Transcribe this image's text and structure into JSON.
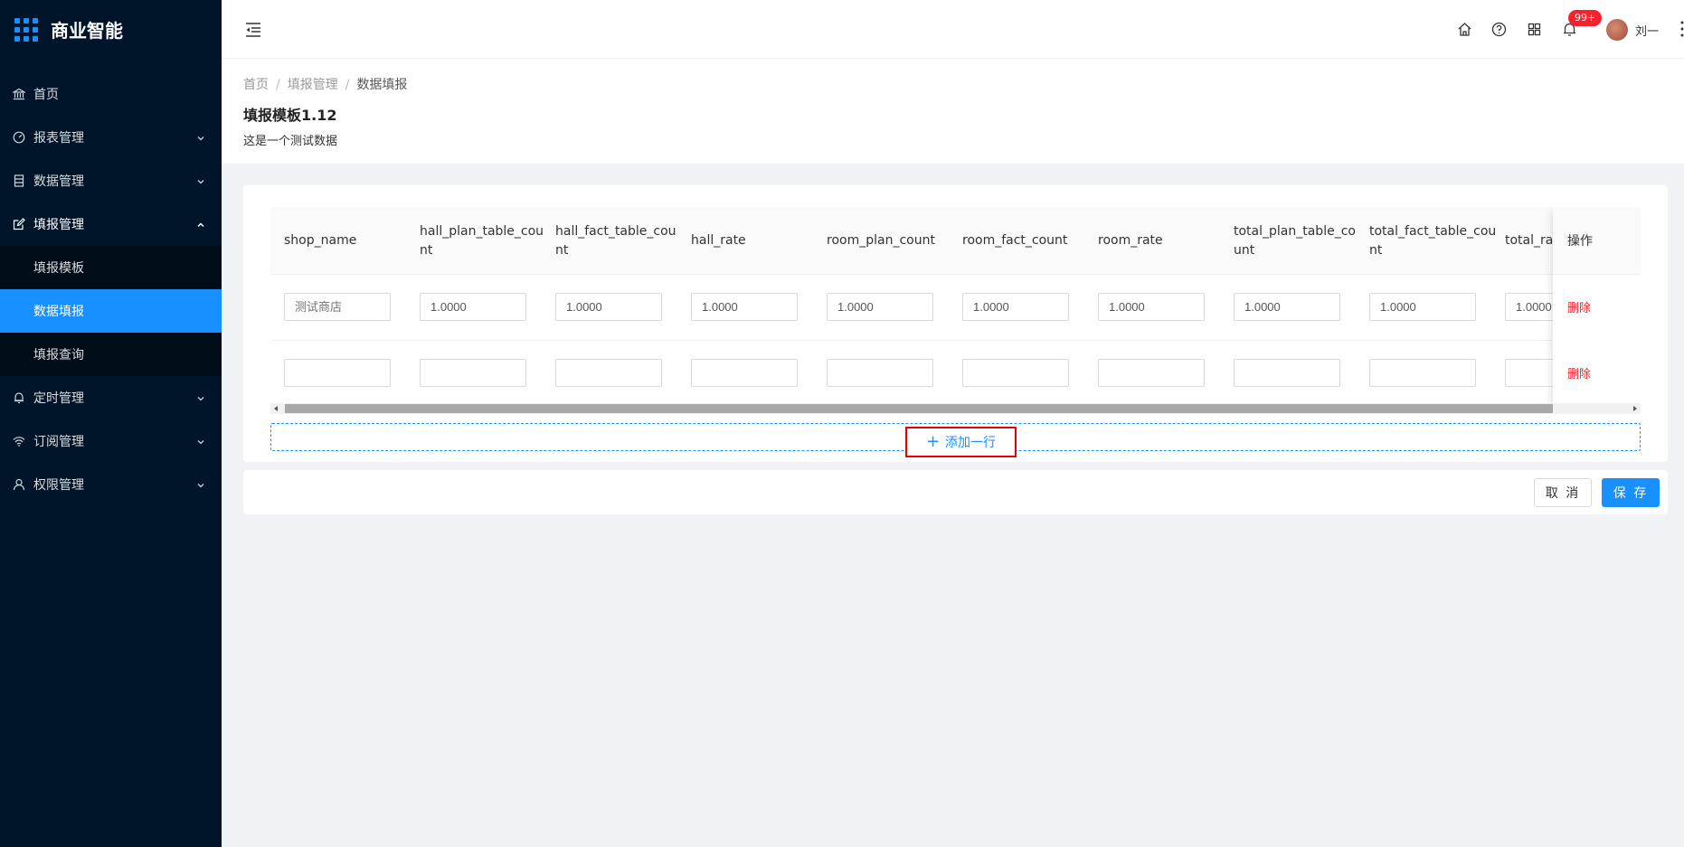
{
  "app": {
    "logo_text": "商业智能"
  },
  "sidebar": {
    "items": [
      {
        "label": "首页",
        "icon": "bank-icon"
      },
      {
        "label": "报表管理",
        "icon": "dashboard-icon"
      },
      {
        "label": "数据管理",
        "icon": "database-icon"
      },
      {
        "label": "填报管理",
        "icon": "edit-icon"
      },
      {
        "label": "定时管理",
        "icon": "bell-icon"
      },
      {
        "label": "订阅管理",
        "icon": "wifi-icon"
      },
      {
        "label": "权限管理",
        "icon": "user-icon"
      }
    ],
    "submenu": [
      {
        "label": "填报模板"
      },
      {
        "label": "数据填报"
      },
      {
        "label": "填报查询"
      }
    ]
  },
  "header": {
    "badge": "99+",
    "username": "刘一"
  },
  "breadcrumb": {
    "items": [
      "首页",
      "填报管理",
      "数据填报"
    ]
  },
  "page": {
    "title": "填报模板1.12",
    "description": "这是一个测试数据"
  },
  "table": {
    "columns": [
      "shop_name",
      "hall_plan_table_count",
      "hall_fact_table_count",
      "hall_rate",
      "room_plan_count",
      "room_fact_count",
      "room_rate",
      "total_plan_table_count",
      "total_fact_table_count",
      "total_rate"
    ],
    "action_header": "操作",
    "rows": [
      {
        "values": [
          "",
          "1.0000",
          "1.0000",
          "1.0000",
          "1.0000",
          "1.0000",
          "1.0000",
          "1.0000",
          "1.0000",
          "1.0000"
        ],
        "placeholders": [
          "测试商店",
          "",
          "",
          "",
          "",
          "",
          "",
          "",
          "",
          ""
        ],
        "action": "删除"
      },
      {
        "values": [
          "",
          "",
          "",
          "",
          "",
          "",
          "",
          "",
          "",
          ""
        ],
        "placeholders": [
          "",
          "",
          "",
          "",
          "",
          "",
          "",
          "",
          "",
          ""
        ],
        "action": "删除"
      }
    ],
    "add_row_label": "添加一行"
  },
  "footer": {
    "cancel_label": "取 消",
    "save_label": "保 存"
  },
  "colors": {
    "sidebar_bg": "#001529",
    "submenu_bg": "#000c17",
    "primary": "#1890ff",
    "danger": "#f5222d",
    "highlight_box": "#e60000"
  }
}
